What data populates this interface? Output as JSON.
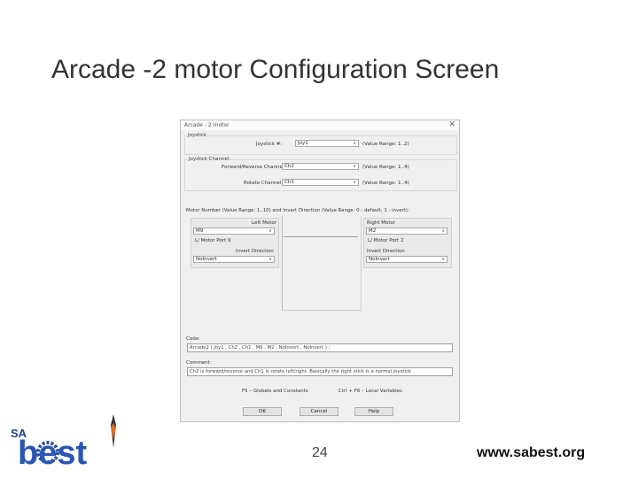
{
  "slide": {
    "title": "Arcade -2 motor Configuration Screen",
    "page_number": "24",
    "website": "www.sabest.org",
    "logo": {
      "text_top": "SA",
      "text_main": "best"
    }
  },
  "dialog": {
    "window_title": "Arcade - 2 motor",
    "close_glyph": "✕",
    "joystick_group": {
      "label": "Joystick",
      "field_label": "Joystick #:",
      "value": "Joy1",
      "range": "(Value Range: 1..2)"
    },
    "channel_group": {
      "label": "Joystick Channel:",
      "fwd_label": "Forward/Reverse Channel:",
      "fwd_value": "Ch2",
      "fwd_range": "(Value Range: 1..4)",
      "rot_label": "Rotate Channel:",
      "rot_value": "Ch1",
      "rot_range": "(Value Range: 1..4)"
    },
    "motor_group": {
      "label": "Motor Number (Value Range: 1..10) and Invert Direction (Value Range: 0 - default, 1 - invert):",
      "left": {
        "label": "Left Motor",
        "value": "M9",
        "port_label": "L/ Motor Port 9",
        "invert_label": "Invert Direction",
        "invert_value": "NoInvert"
      },
      "right": {
        "label": "Right Motor",
        "value": "M2",
        "port_label": "L/ Motor Port 2",
        "invert_label": "Invert Direction",
        "invert_value": "NoInvert"
      }
    },
    "code": {
      "label": "Code:",
      "value": "Arcade2 ( Joy1 , Ch2 , Ch1 , M9 , M2 , NoInvert , NoInvert ) ;"
    },
    "comment": {
      "label": "Comment:",
      "value": "Ch2 is forward/reverse and Ch1 is rotate left/right. Basically the right stick is a normal joystick"
    },
    "hints": {
      "left": "F5 – Globals and Constants",
      "right": "Ctrl + F6 – Local Variables"
    },
    "buttons": {
      "ok": "OK",
      "cancel": "Cancel",
      "help": "Help"
    },
    "dropdown_glyph": "∨"
  }
}
